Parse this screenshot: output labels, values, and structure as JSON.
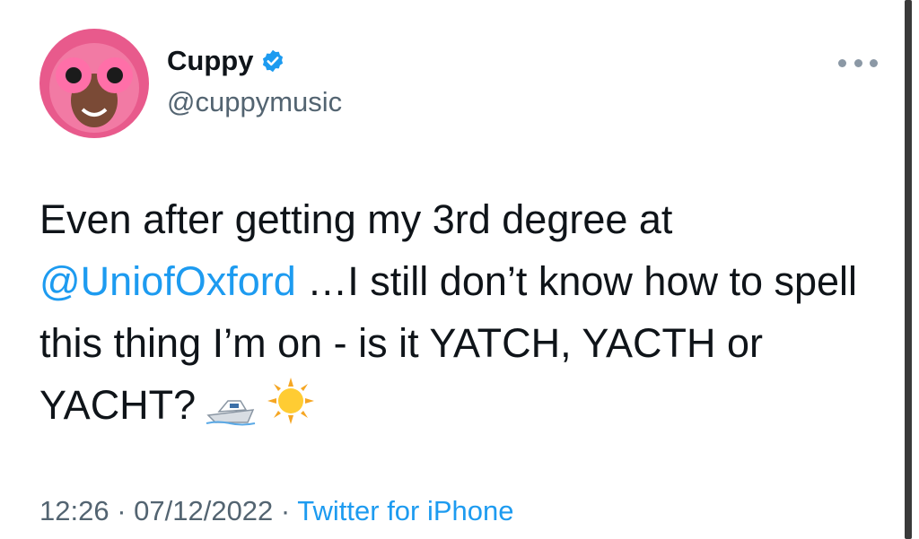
{
  "profile": {
    "name": "Cuppy",
    "handle": "@cuppymusic",
    "verified": true,
    "avatar_icon": "profile-photo-pink-glasses"
  },
  "menu": {
    "icon": "more-options-icon"
  },
  "tweet": {
    "text_part1": "Even after getting my 3rd degree at ",
    "mention": "@UniofOxford",
    "text_part2": " …I still don’t know how to spell this thing I’m on - is it YATCH, YACTH or YACHT?",
    "emojis": [
      "boat-emoji",
      "sun-emoji"
    ]
  },
  "footer": {
    "time": "12:26",
    "sep1": " · ",
    "date": "07/12/2022",
    "sep2": " · ",
    "source": "Twitter for iPhone"
  },
  "colors": {
    "link": "#1d9bf0",
    "text": "#0f1419",
    "secondary": "#536471"
  }
}
